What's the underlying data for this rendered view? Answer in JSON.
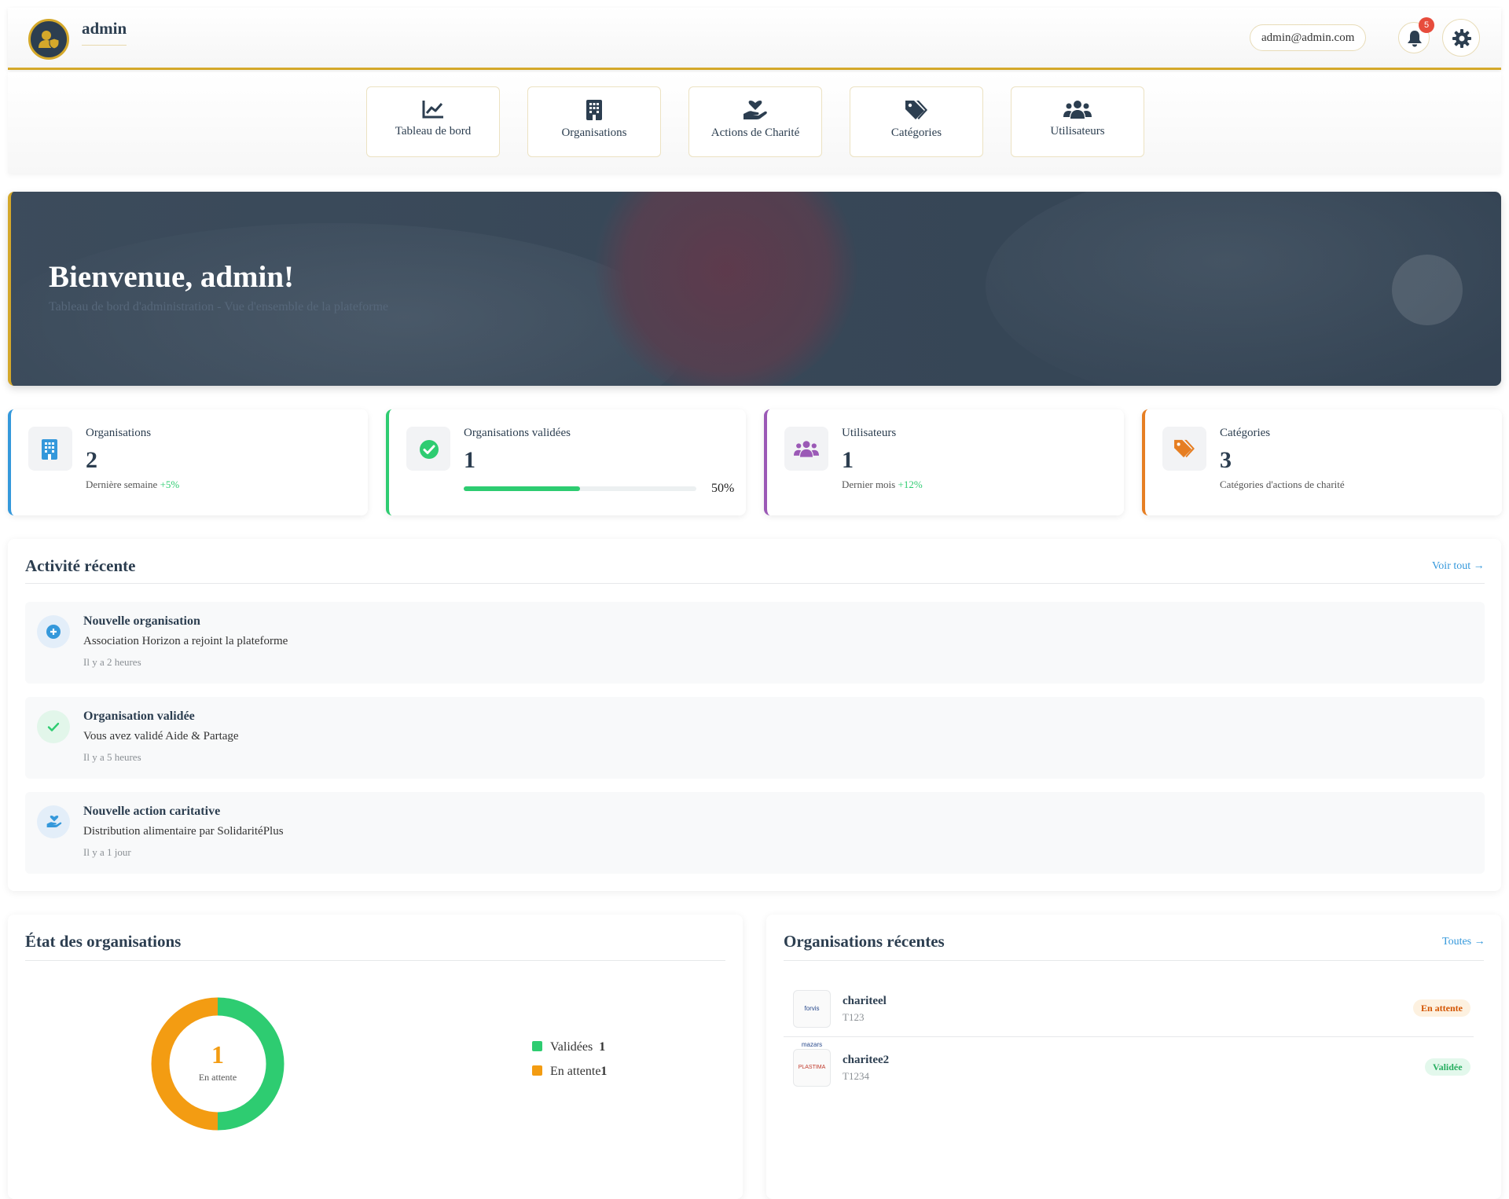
{
  "header": {
    "username": "admin",
    "email": "admin@admin.com",
    "notification_count": "5"
  },
  "nav": {
    "items": [
      {
        "label": "Tableau de bord",
        "icon": "chart-line-icon"
      },
      {
        "label": "Organisations",
        "icon": "building-icon"
      },
      {
        "label": "Actions de Charité",
        "icon": "hand-heart-icon"
      },
      {
        "label": "Catégories",
        "icon": "tags-icon"
      },
      {
        "label": "Utilisateurs",
        "icon": "users-icon"
      }
    ]
  },
  "hero": {
    "title": "Bienvenue, admin!",
    "subtitle": "Tableau de bord d'administration - Vue d'ensemble de la plateforme"
  },
  "stats": [
    {
      "label": "Organisations",
      "value": "2",
      "foot": "Dernière semaine",
      "trend": "+5%",
      "accent": "#3498db",
      "icon": "building-icon"
    },
    {
      "label": "Organisations validées",
      "value": "1",
      "progress": 50,
      "progress_label": "50%",
      "accent": "#2ecc71",
      "icon": "check-circle-icon"
    },
    {
      "label": "Utilisateurs",
      "value": "1",
      "foot": "Dernier mois",
      "trend": "+12%",
      "accent": "#9b59b6",
      "icon": "users-icon"
    },
    {
      "label": "Catégories",
      "value": "3",
      "foot": "Catégories d'actions de charité",
      "accent": "#e67e22",
      "icon": "tags-icon"
    }
  ],
  "activity": {
    "title": "Activité récente",
    "link": "Voir tout",
    "items": [
      {
        "title": "Nouvelle organisation",
        "desc": "Association Horizon a rejoint la plateforme",
        "time": "Il y a 2 heures",
        "icon": "plus-circle-icon"
      },
      {
        "title": "Organisation validée",
        "desc": "Vous avez validé Aide & Partage",
        "time": "Il y a 5 heures",
        "icon": "check-icon"
      },
      {
        "title": "Nouvelle action caritative",
        "desc": "Distribution alimentaire par SolidaritéPlus",
        "time": "Il y a 1 jour",
        "icon": "hand-heart-icon"
      }
    ]
  },
  "org_status": {
    "title": "État des organisations",
    "center_value": "1",
    "center_label": "En attente"
  },
  "chart_data": {
    "type": "pie",
    "categories": [
      "Validées",
      "En attente"
    ],
    "values": [
      1,
      1
    ],
    "colors": [
      "#2ecc71",
      "#f39c12"
    ],
    "legend": "right"
  },
  "recent_orgs": {
    "title": "Organisations récentes",
    "link": "Toutes",
    "items": [
      {
        "name": "chariteel",
        "code": "T123",
        "status": "En attente",
        "logo_text": "forvis mazars"
      },
      {
        "name": "charitee2",
        "code": "T1234",
        "status": "Validée",
        "logo_text": "PLASTIMA"
      }
    ]
  }
}
